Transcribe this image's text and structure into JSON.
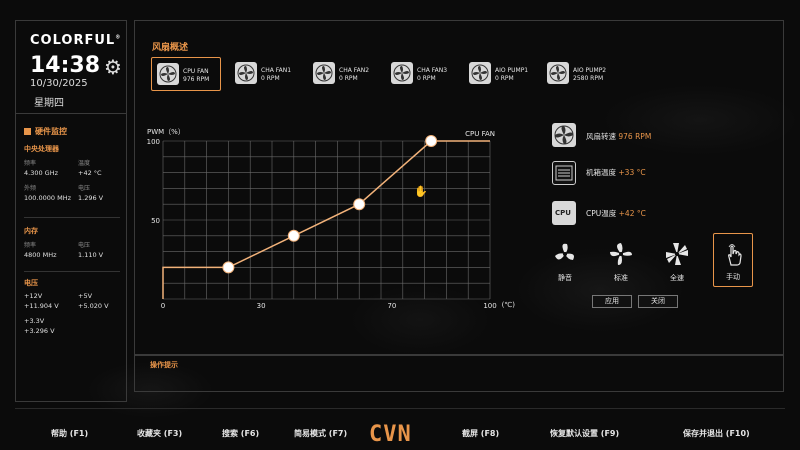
{
  "sidebar": {
    "brand": "COLORFUL",
    "brand_mark": "®",
    "time": "14:38",
    "date": "10/30/2025",
    "weekday": "星期四",
    "hw_title": "硬件监控",
    "cpu": {
      "title": "中央处理器",
      "freq_label": "频率",
      "freq_value": "4.300 GHz",
      "temp_label": "温度",
      "temp_value": "+42 °C",
      "ext_label": "外频",
      "ext_value": "100.0000 MHz",
      "volt_label": "电压",
      "volt_value": "1.296 V"
    },
    "memory": {
      "title": "内存",
      "freq_label": "频率",
      "freq_value": "4800 MHz",
      "volt_label": "电压",
      "volt_value": "1.110 V"
    },
    "voltage": {
      "title": "电压",
      "v12_label": "+12V",
      "v12_value": "+11.904 V",
      "v5_label": "+5V",
      "v5_value": "+5.020 V",
      "v33_label": "+3.3V",
      "v33_value": "+3.296 V"
    }
  },
  "main": {
    "title": "风扇概述",
    "fans": [
      {
        "name": "CPU FAN",
        "rpm": "976 RPM"
      },
      {
        "name": "CHA FAN1",
        "rpm": "0 RPM"
      },
      {
        "name": "CHA FAN2",
        "rpm": "0 RPM"
      },
      {
        "name": "CHA FAN3",
        "rpm": "0 RPM"
      },
      {
        "name": "AIO PUMP1",
        "rpm": "0 RPM"
      },
      {
        "name": "AIO PUMP2",
        "rpm": "2580 RPM"
      }
    ],
    "info": {
      "fan_speed_label": "风扇转速",
      "fan_speed_value": "976 RPM",
      "case_temp_label": "机箱温度",
      "case_temp_value": "+33 °C",
      "cpu_temp_label": "CPU温度",
      "cpu_temp_value": "+42 °C",
      "cpu_icon_text": "CPU"
    },
    "modes": [
      "静音",
      "标准",
      "全速",
      "手动"
    ],
    "active_mode": "手动",
    "apply_label": "应用",
    "close_label": "关闭"
  },
  "chart_data": {
    "type": "line",
    "title": "CPU FAN",
    "ylabel": "PWM（%）",
    "xlabel": "(℃)",
    "xlim": [
      0,
      100
    ],
    "ylim": [
      0,
      100
    ],
    "x_ticks": [
      "0",
      "30",
      "70",
      "100"
    ],
    "y_ticks": [
      "50",
      "100"
    ],
    "grid": true,
    "series": [
      {
        "name": "CPU FAN",
        "x": [
          0,
          0,
          20,
          40,
          60,
          82,
          100
        ],
        "y": [
          0,
          20,
          20,
          40,
          60,
          100,
          100
        ],
        "control_points": [
          [
            20,
            20
          ],
          [
            40,
            40
          ],
          [
            60,
            60
          ],
          [
            82,
            100
          ]
        ]
      }
    ]
  },
  "tips": {
    "title": "操作提示"
  },
  "footer": {
    "help": "帮助 (F1)",
    "favorites": "收藏夹 (F3)",
    "search": "搜索 (F6)",
    "easy_mode": "简易模式 (F7)",
    "logo": "CVN",
    "screenshot": "截屏 (F8)",
    "restore_defaults": "恢复默认设置 (F9)",
    "save_exit": "保存并退出 (F10)"
  },
  "colors": {
    "accent": "#e8954a",
    "border": "#3a3a3a",
    "background": "#0b0b0b"
  },
  "icons": [
    "gear-icon",
    "fan-icon",
    "chassis-icon",
    "cpu-icon",
    "silent-fan-icon",
    "standard-fan-icon",
    "full-speed-fan-icon",
    "manual-hand-icon"
  ]
}
